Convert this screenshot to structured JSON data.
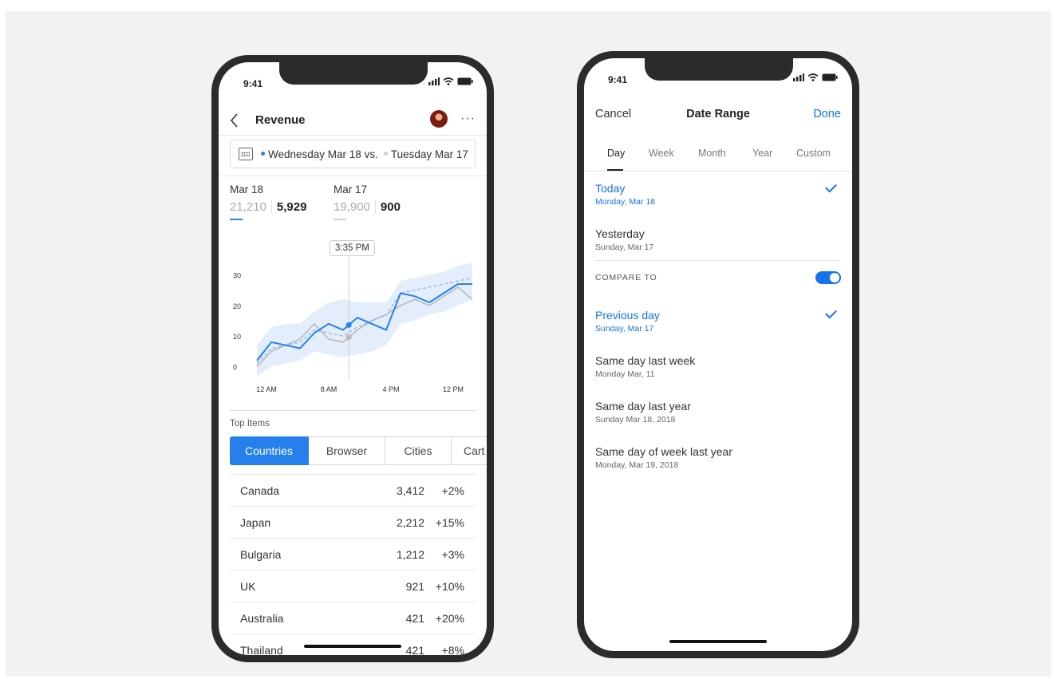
{
  "colors": {
    "accent": "#2680eb",
    "link": "#1473e6",
    "compare": "#b8b8b8",
    "band": "#e4eefb"
  },
  "status": {
    "time": "9:41"
  },
  "revenue_screen": {
    "title": "Revenue",
    "date_range": {
      "primary": "Wednesday Mar 18 vs.",
      "compare": "Tuesday Mar 17"
    },
    "metrics": [
      {
        "date": "Mar 18",
        "prev_value": "21,210",
        "value": "5,929"
      },
      {
        "date": "Mar 17",
        "prev_value": "19,900",
        "value": "900"
      }
    ],
    "tooltip": "3:35 PM",
    "top_items_label": "Top Items",
    "tabs": [
      "Countries",
      "Browser",
      "Cities",
      "Cart"
    ],
    "rows": [
      {
        "name": "Canada",
        "value": "3,412",
        "change": "+2%"
      },
      {
        "name": "Japan",
        "value": "2,212",
        "change": "+15%"
      },
      {
        "name": "Bulgaria",
        "value": "1,212",
        "change": "+3%"
      },
      {
        "name": "UK",
        "value": "921",
        "change": "+10%"
      },
      {
        "name": "Australia",
        "value": "421",
        "change": "+20%"
      },
      {
        "name": "Thailand",
        "value": "421",
        "change": "+8%"
      }
    ]
  },
  "chart_data": {
    "type": "line",
    "x": [
      0,
      1,
      2,
      3,
      4,
      5,
      6,
      7,
      8,
      9,
      10,
      11,
      12,
      13,
      14,
      15
    ],
    "xticks": [
      "12 AM",
      "8 AM",
      "4 PM",
      "12 PM"
    ],
    "yticks": [
      "30",
      "20",
      "10",
      "0"
    ],
    "ylim": [
      -3,
      33
    ],
    "series": [
      {
        "role": "current",
        "values": [
          2,
          8,
          7,
          6,
          11,
          14,
          12,
          16,
          14,
          12,
          24,
          23,
          21,
          24,
          27,
          27
        ]
      },
      {
        "role": "previous",
        "values": [
          0,
          5,
          7,
          9,
          14,
          9,
          8,
          12,
          15,
          17,
          20,
          22,
          20,
          23,
          26,
          22
        ]
      },
      {
        "role": "average",
        "values": [
          1,
          6,
          7,
          8,
          12,
          11,
          10,
          13,
          15,
          17,
          24,
          25,
          26,
          27,
          28,
          29
        ]
      }
    ],
    "band_upper": [
      7,
      13,
      14,
      14,
      18,
      21,
      22,
      21,
      21,
      21,
      28,
      29,
      30,
      31,
      33,
      34
    ],
    "band_lower": [
      -3,
      0,
      1,
      2,
      5,
      4,
      3,
      4,
      5,
      7,
      14,
      15,
      17,
      18,
      20,
      22
    ],
    "highlight_x": 6.4
  },
  "date_range_screen": {
    "cancel": "Cancel",
    "title": "Date Range",
    "done": "Done",
    "segments": [
      "Day",
      "Week",
      "Month",
      "Year",
      "Custom"
    ],
    "options": [
      {
        "label": "Today",
        "sub": "Monday, Mar 18",
        "selected": true
      },
      {
        "label": "Yesterday",
        "sub": "Sunday, Mar 17",
        "selected": false
      }
    ],
    "compare_to": "COMPARE TO",
    "compare_enabled": true,
    "compare_options": [
      {
        "label": "Previous day",
        "sub": "Sunday, Mar 17",
        "selected": true
      },
      {
        "label": "Same day last week",
        "sub": "Monday Mar, 11",
        "selected": false
      },
      {
        "label": "Same day last year",
        "sub": "Sunday Mar 18, 2018",
        "selected": false
      },
      {
        "label": "Same day of week last year",
        "sub": "Monday, Mar 19, 2018",
        "selected": false
      }
    ]
  }
}
